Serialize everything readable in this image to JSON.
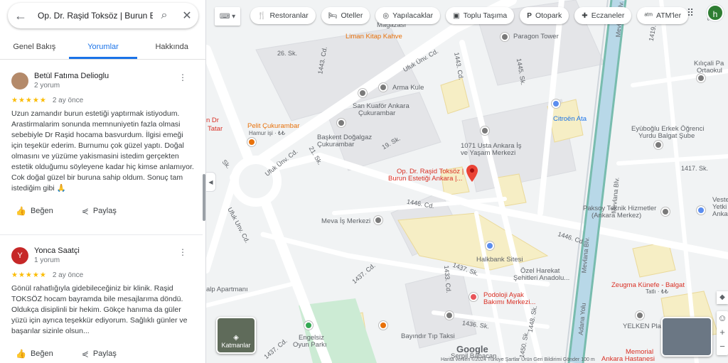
{
  "search": {
    "query": "Op. Dr. Raşid Toksöz | Burun Es"
  },
  "tabs": [
    {
      "label": "Genel Bakış"
    },
    {
      "label": "Yorumlar"
    },
    {
      "label": "Hakkında"
    }
  ],
  "reviews": [
    {
      "name": "Betül Fatıma Delioglu",
      "count": "2 yorum",
      "stars": "★★★★★",
      "when": "2 ay önce",
      "text": "Uzun zamandır burun estetiği yaptırmak istiyodum. Arastirmalarim sonunda memnuniyetin fazla olmasi sebebiyle Dr Raşid hocama basvurdum. İlgisi emeği için teşekür ederim. Burnumu çok güzel yaptı. Doğal olmasını ve yüzüme yakismasini istedim gerçekten estetik olduğumu söyleyene kadar hiç kimse anlamıyor. Cok doğal güzel bir buruna sahip oldum. Sonuç tam istediğim gibi 🙏",
      "like": "Beğen",
      "share": "Paylaş"
    },
    {
      "name": "Yonca Saatçi",
      "initial": "Y",
      "count": "1 yorum",
      "stars": "★★★★★",
      "when": "2 ay önce",
      "text": "Gönül rahatlığıyla gidebileceğiniz bir klinik. Raşid TOKSÖZ hocam bayramda bile mesajlarıma döndü. Oldukça disiplinli bir hekim. Gökçe hanıma da güler yüzü için ayrıca teşekkür ediyorum. Sağlıklı günler ve başarılar sizinle olsun...",
      "like": "Beğen",
      "share": "Paylaş"
    }
  ],
  "chips": [
    {
      "icon": "restaurant-icon",
      "glyph": "🍴",
      "label": "Restoranlar"
    },
    {
      "icon": "hotel-icon",
      "glyph": "🛏",
      "label": "Oteller"
    },
    {
      "icon": "camera-icon",
      "glyph": "◎",
      "label": "Yapılacaklar"
    },
    {
      "icon": "bus-icon",
      "glyph": "▣",
      "label": "Toplu Taşıma"
    },
    {
      "icon": "parking-icon",
      "glyph": "P",
      "label": "Otopark"
    },
    {
      "icon": "pharmacy-icon",
      "glyph": "✚",
      "label": "Eczaneler"
    },
    {
      "icon": "atm-icon",
      "glyph": "ᵃᵗᵐ",
      "label": "ATM'ler"
    }
  ],
  "profile": {
    "initial": "h"
  },
  "map_labels": {
    "liman": "Liman Kitap Kahve",
    "magaza": "Mağazası",
    "paragon": "Paragon Tower",
    "arma": "Arma Kule",
    "kuafor1": "San Kuaför Ankara",
    "kuafor2": "Çukurambar",
    "pelit1": "Pelit Çukurambar",
    "pelit2": "Hamur işi · ₺₺",
    "dogalgaz1": "Başkent Doğalgaz",
    "dogalgaz2": "Çukurambar",
    "tatar1": "n Dr",
    "tatar2": "Tatar",
    "citroen": "Citroën Ata",
    "usta1": "1071 Usta Ankara İş",
    "usta2": "ve Yaşam Merkezi",
    "clinic1": "Op. Dr. Raşid Toksöz |",
    "clinic2": "Burun Estetiği Ankara |...",
    "eyubog1": "Eyüboğlu Erkek Öğrenci",
    "eyubog2": "Yurdu Balgat Şube",
    "kilicali1": "Kılıçali Pa",
    "kilicali2": "Ortaokul",
    "meva": "Meva İş Merkezi",
    "paksoy1": "Paksoy Teknik Hizmetler",
    "paksoy2": "(Ankara Merkez)",
    "halkbank": "Halkbank Sitesi",
    "ozel1": "Özel Harekat",
    "ozel2": "Şehitleri Anadolu...",
    "zeugma1": "Zeugma Künefe - Balgat",
    "zeugma2": "Tatlı · ₺₺",
    "podoloji1": "Podoloji Ayak",
    "podoloji2": "Bakımı Merkezi...",
    "apartman": "alp Apartmanı",
    "bayindir": "Bayındır Tıp Taksi",
    "engelsiz1": "Engelsiz",
    "engelsiz2": "Oyun Parkı",
    "serpil1": "Serpil Babacan",
    "yelken": "YELKEN Plaza",
    "memorial1": "Memorial",
    "memorial2": "Ankara Hastanesi",
    "veste1": "Veste",
    "veste2": "Yetki",
    "veste3": "Ankara",
    "road_26": "26. Sk.",
    "road_1443": "1443. Cd.",
    "road_1445": "1445. Sk.",
    "road_ufuk1": "Ufuk Ünv. Cd.",
    "road_ufuk2": "Ufuk Ünv. Cd.",
    "road_ufuk3": "Ufuk Unv. Cd.",
    "road_19": "19. Sk.",
    "road_21": "21. Sk.",
    "road_1446": "1446. Cd.",
    "road_1446b": "1446. Cd.",
    "road_1437": "1437. Cd.",
    "road_1437b": "1437. Sk.",
    "road_1437c": "1437. Cd.",
    "road_1433": "1433. Cd.",
    "road_1436": "1436. Sk.",
    "road_1417": "1417. Sk.",
    "road_1419": "1419. Sk.",
    "road_mevlana1": "Mevlana Blv.",
    "road_mevlana2": "Mevlana Blv.",
    "road_adana": "Adana Yolu",
    "road_1450": "1450. Sk.",
    "road_1448": "1448. Sk.",
    "road_s": "Sk."
  },
  "layers_label": "Katmanlar",
  "google_logo": "Google",
  "footer": "Harita verileri ©2024   Türkiye   Şartlar   Ürün Geri Bildirimi Gönder   100 m"
}
